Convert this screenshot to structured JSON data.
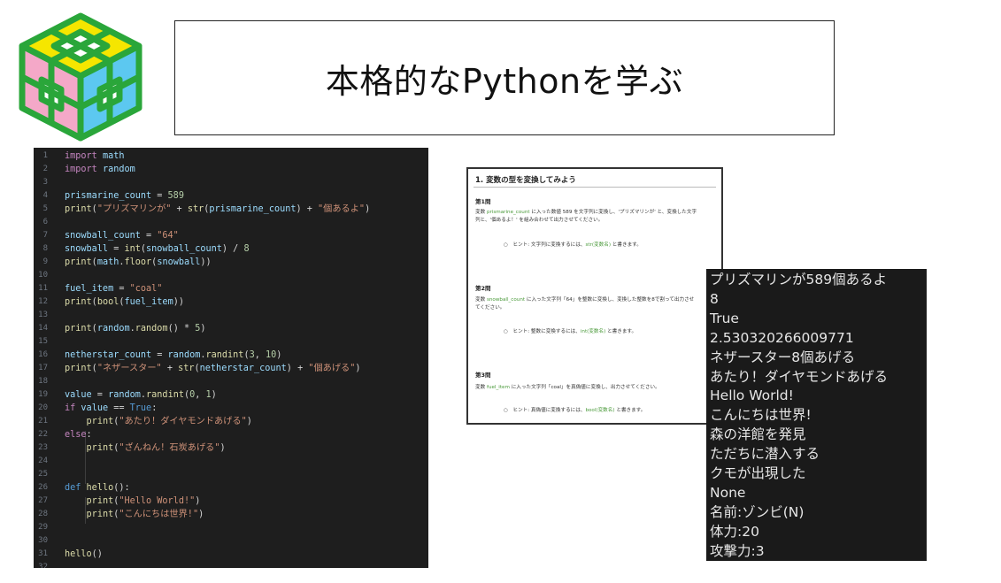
{
  "header": {
    "title": "本格的なPythonを学ぶ"
  },
  "editor": {
    "lines": [
      {
        "n": "1",
        "html": "<span class=\"kw\">import</span> <span class=\"var\">math</span>"
      },
      {
        "n": "2",
        "html": "<span class=\"kw\">import</span> <span class=\"var\">random</span>"
      },
      {
        "n": "3",
        "html": ""
      },
      {
        "n": "4",
        "html": "<span class=\"var\">prismarine_count</span> = <span class=\"num\">589</span>"
      },
      {
        "n": "5",
        "html": "<span class=\"fn\">print</span>(<span class=\"str\">\"プリズマリンが\"</span> + <span class=\"fn\">str</span>(<span class=\"var\">prismarine_count</span>) + <span class=\"str\">\"個あるよ\"</span>)"
      },
      {
        "n": "6",
        "html": ""
      },
      {
        "n": "7",
        "html": "<span class=\"var\">snowball_count</span> = <span class=\"str\">\"64\"</span>"
      },
      {
        "n": "8",
        "html": "<span class=\"var\">snowball</span> = <span class=\"fn\">int</span>(<span class=\"var\">snowball_count</span>) / <span class=\"num\">8</span>"
      },
      {
        "n": "9",
        "html": "<span class=\"fn\">print</span>(<span class=\"var\">math</span>.<span class=\"fn\">floor</span>(<span class=\"var\">snowball</span>))"
      },
      {
        "n": "10",
        "html": ""
      },
      {
        "n": "11",
        "html": "<span class=\"var\">fuel_item</span> = <span class=\"str\">\"coal\"</span>"
      },
      {
        "n": "12",
        "html": "<span class=\"fn\">print</span>(<span class=\"fn\">bool</span>(<span class=\"var\">fuel_item</span>))"
      },
      {
        "n": "13",
        "html": ""
      },
      {
        "n": "14",
        "html": "<span class=\"fn\">print</span>(<span class=\"var\">random</span>.<span class=\"fn\">random</span>() * <span class=\"num\">5</span>)"
      },
      {
        "n": "15",
        "html": ""
      },
      {
        "n": "16",
        "html": "<span class=\"var\">netherstar_count</span> = <span class=\"var\">random</span>.<span class=\"fn\">randint</span>(<span class=\"num\">3</span>, <span class=\"num\">10</span>)"
      },
      {
        "n": "17",
        "html": "<span class=\"fn\">print</span>(<span class=\"str\">\"ネザースター\"</span> + <span class=\"fn\">str</span>(<span class=\"var\">netherstar_count</span>) + <span class=\"str\">\"個あげる\"</span>)"
      },
      {
        "n": "18",
        "html": ""
      },
      {
        "n": "19",
        "html": "<span class=\"var\">value</span> = <span class=\"var\">random</span>.<span class=\"fn\">randint</span>(<span class=\"num\">0</span>, <span class=\"num\">1</span>)"
      },
      {
        "n": "20",
        "html": "<span class=\"kw\">if</span> <span class=\"var\">value</span> == <span class=\"bool\">True</span>:"
      },
      {
        "n": "21",
        "html": "    <span class=\"fn\">print</span>(<span class=\"str\">\"あたり！ダイヤモンドあげる\"</span>)"
      },
      {
        "n": "22",
        "html": "<span class=\"kw\">else</span>:"
      },
      {
        "n": "23",
        "html": "    <span class=\"fn\">print</span>(<span class=\"str\">\"ざんねん！石炭あげる\"</span>)"
      },
      {
        "n": "24",
        "html": ""
      },
      {
        "n": "25",
        "html": ""
      },
      {
        "n": "26",
        "html": "<span class=\"bool\">def</span> <span class=\"fn\">hello</span>():"
      },
      {
        "n": "27",
        "html": "    <span class=\"fn\">print</span>(<span class=\"str\">\"Hello World!\"</span>)"
      },
      {
        "n": "28",
        "html": "    <span class=\"fn\">print</span>(<span class=\"str\">\"こんにちは世界!\"</span>)"
      },
      {
        "n": "29",
        "html": ""
      },
      {
        "n": "30",
        "html": ""
      },
      {
        "n": "31",
        "html": "<span class=\"fn\">hello</span>()"
      },
      {
        "n": "32",
        "html": ""
      }
    ]
  },
  "worksheet": {
    "title": "1. 変数の型を変換してみよう",
    "q1": {
      "label": "第1問",
      "body_a": "変数 ",
      "body_var": "prismarine_count",
      "body_b": " に入った数値 589 を文字列に変換し、'プリズマリンが' と、変換した文字",
      "body_c": "列と、'個あるよ！' を組み合わせて出力させてください。",
      "hint_a": "○　ヒント: 文字列に変換するには、",
      "hint_code": "str(変数名)",
      "hint_b": " と書きます。"
    },
    "q2": {
      "label": "第2問",
      "body_a": "変数 ",
      "body_var": "snowball_count",
      "body_b": " に入った文字列「64」を整数に変換し、変換した整数を8で割って出力させ",
      "body_c": "てください。",
      "hint_a": "○　ヒント: 整数に変換するには、",
      "hint_code": "int(変数名)",
      "hint_b": " と書きます。"
    },
    "q3": {
      "label": "第3問",
      "body_a": "変数 ",
      "body_var": "fuel_item",
      "body_b": " に入った文字列「coal」を真偽値に変換し、出力させてください。",
      "hint_a": "○　ヒント: 真偽値に変換するには、",
      "hint_code": "bool(変数名)",
      "hint_b": " と書きます。"
    }
  },
  "terminal": {
    "lines": [
      "プリズマリンが589個あるよ",
      "8",
      "True",
      "2.530320266009771",
      "ネザースター8個あげる",
      "あたり！ダイヤモンドあげる",
      "Hello World!",
      "こんにちは世界!",
      "森の洋館を発見",
      "ただちに潜入する",
      "クモが出現した",
      "None",
      "名前:ゾンビ(N)",
      "体力:20",
      "攻撃力:3"
    ]
  },
  "colors": {
    "logo_green": "#2aa63a",
    "logo_yellow": "#f5e600",
    "logo_pink": "#f4a8c8",
    "logo_blue": "#5cc8f0"
  }
}
